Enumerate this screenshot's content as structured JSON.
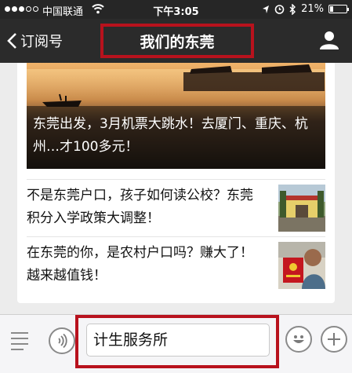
{
  "status_bar": {
    "carrier": "中国联通",
    "time": "下午3:05",
    "battery_percent_label": "21%",
    "battery_level": 0.21,
    "icons": [
      "signal-dots",
      "wifi-icon",
      "alarm-icon",
      "bluetooth-icon",
      "battery-icon"
    ]
  },
  "nav": {
    "back_label": "订阅号",
    "title": "我们的东莞",
    "icons": [
      "chevron-left-icon",
      "person-icon"
    ]
  },
  "articles": {
    "headline": "东莞出发，3月机票大跳水！去厦门、重庆、杭州…才100多元！",
    "items": [
      {
        "title": "不是东莞户口，孩子如何读公校？东莞积分入学政策大调整！"
      },
      {
        "title": "在东莞的你，是农村户口吗？赚大了！越来越值钱！"
      }
    ]
  },
  "input_bar": {
    "value": "计生服务所",
    "icons": [
      "menu-icon",
      "voice-icon",
      "emoji-icon",
      "plus-icon"
    ]
  },
  "colors": {
    "highlight_frame": "#b8121d",
    "nav_background": "#2b2b2b",
    "status_background": "#262626"
  }
}
